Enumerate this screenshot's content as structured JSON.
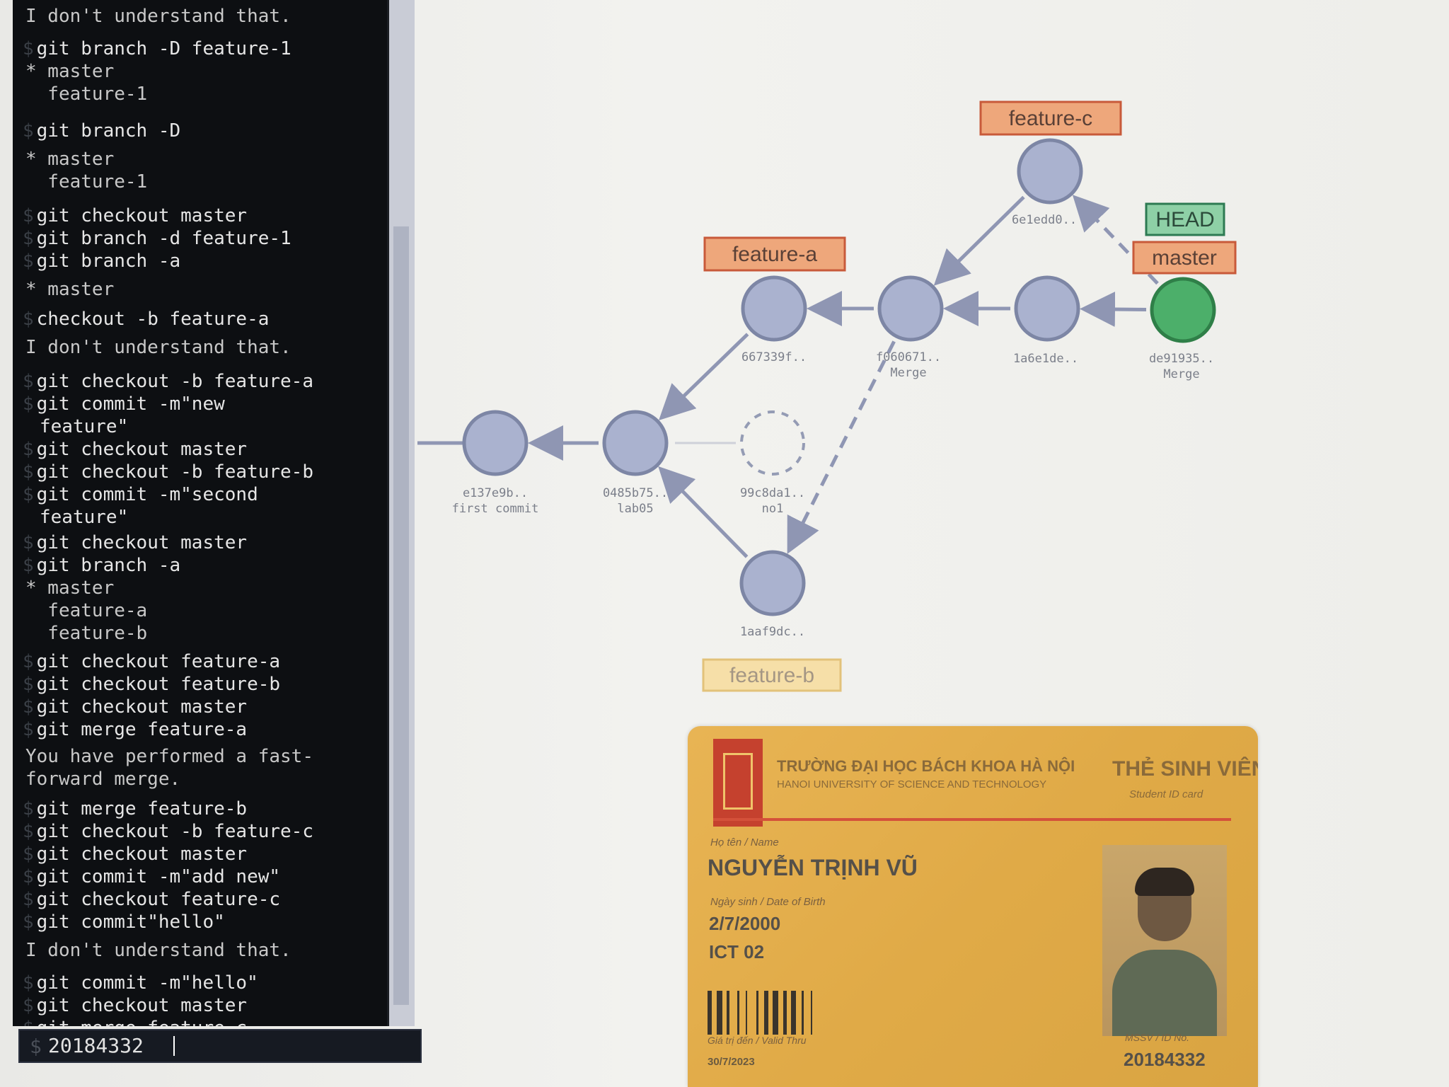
{
  "terminal": {
    "lines": [
      {
        "type": "out",
        "text": "I don't understand that.",
        "faded": true
      },
      {
        "type": "cmd",
        "text": "git branch -D feature-1"
      },
      {
        "type": "out",
        "text": "* master"
      },
      {
        "type": "out",
        "text": "  feature-1"
      },
      {
        "type": "cmd",
        "text": "git branch -D"
      },
      {
        "type": "out",
        "text": "* master"
      },
      {
        "type": "out",
        "text": "  feature-1"
      },
      {
        "type": "cmd",
        "text": "git checkout master"
      },
      {
        "type": "cmd",
        "text": "git branch -d feature-1"
      },
      {
        "type": "cmd",
        "text": "git branch -a"
      },
      {
        "type": "out",
        "text": "* master"
      },
      {
        "type": "cmd",
        "text": "checkout -b feature-a"
      },
      {
        "type": "out",
        "text": "I don't understand that."
      },
      {
        "type": "cmd",
        "text": "git checkout -b feature-a"
      },
      {
        "type": "cmd",
        "text": "git commit -m\"new"
      },
      {
        "type": "cont",
        "text": "feature\""
      },
      {
        "type": "cmd",
        "text": "git checkout master"
      },
      {
        "type": "cmd",
        "text": "git checkout -b feature-b"
      },
      {
        "type": "cmd",
        "text": "git commit -m\"second"
      },
      {
        "type": "cont",
        "text": "feature\""
      },
      {
        "type": "cmd",
        "text": "git checkout master"
      },
      {
        "type": "cmd",
        "text": "git branch -a"
      },
      {
        "type": "out",
        "text": "* master"
      },
      {
        "type": "out",
        "text": "  feature-a"
      },
      {
        "type": "out",
        "text": "  feature-b"
      },
      {
        "type": "cmd",
        "text": "git checkout feature-a"
      },
      {
        "type": "cmd",
        "text": "git checkout feature-b"
      },
      {
        "type": "cmd",
        "text": "git checkout master"
      },
      {
        "type": "cmd",
        "text": "git merge feature-a"
      },
      {
        "type": "out",
        "text": "You have performed a fast-"
      },
      {
        "type": "out",
        "text": "forward merge."
      },
      {
        "type": "cmd",
        "text": "git merge feature-b"
      },
      {
        "type": "cmd",
        "text": "git checkout -b feature-c"
      },
      {
        "type": "cmd",
        "text": "git checkout master"
      },
      {
        "type": "cmd",
        "text": "git commit -m\"add new\""
      },
      {
        "type": "cmd",
        "text": "git checkout feature-c"
      },
      {
        "type": "cmd",
        "text": "git commit\"hello\""
      },
      {
        "type": "out",
        "text": "I don't understand that."
      },
      {
        "type": "cmd",
        "text": "git commit -m\"hello\""
      },
      {
        "type": "cmd",
        "text": "git checkout master"
      },
      {
        "type": "cmd",
        "text": "git merge feature-c"
      }
    ],
    "prompt_symbol": "$",
    "input_value": "20184332"
  },
  "graph": {
    "commits": [
      {
        "id": "e137e9b..",
        "message": "first commit",
        "style": "normal"
      },
      {
        "id": "0485b75..",
        "message": "lab05",
        "style": "normal"
      },
      {
        "id": "99c8da1..",
        "message": "no1",
        "style": "ghost"
      },
      {
        "id": "1aaf9dc..",
        "message": "",
        "style": "normal"
      },
      {
        "id": "667339f..",
        "message": "",
        "style": "normal"
      },
      {
        "id": "f060671..",
        "message": "Merge",
        "style": "normal"
      },
      {
        "id": "1a6e1de..",
        "message": "",
        "style": "normal"
      },
      {
        "id": "6e1edd0..",
        "message": "",
        "style": "normal"
      },
      {
        "id": "de91935..",
        "message": "Merge",
        "style": "head"
      }
    ],
    "branches": [
      {
        "name": "feature-c",
        "style": "active"
      },
      {
        "name": "feature-a",
        "style": "active"
      },
      {
        "name": "master",
        "style": "active"
      },
      {
        "name": "feature-b",
        "style": "inactive"
      }
    ],
    "head_label": "HEAD",
    "colors": {
      "commit_fill": "#aab2cf",
      "commit_stroke": "#7d86a5",
      "head_fill": "#4caf6a",
      "head_stroke": "#2f7f48",
      "branch_fill": "#eea77b",
      "branch_stroke": "#c85a3a",
      "branch_inactive_fill": "#f6dfa8",
      "branch_inactive_stroke": "#e2c27a",
      "head_box_fill": "#8ed0a6",
      "head_box_stroke": "#2d7a52",
      "arrow": "#8f96b3"
    }
  },
  "id_card": {
    "university_vn": "TRƯỜNG ĐẠI HỌC BÁCH KHOA HÀ NỘI",
    "university_en": "HANOI UNIVERSITY OF SCIENCE AND TECHNOLOGY",
    "title": "THẺ SINH VIÊN",
    "subtitle": "Student ID card",
    "name_label": "Họ tên / Name",
    "name": "NGUYỄN TRỊNH VŨ",
    "dob_label": "Ngày sinh / Date of Birth",
    "dob": "2/7/2000",
    "class": "ICT 02",
    "valid_label": "Giá trị đến / Valid Thru",
    "valid": "30/7/2023",
    "mssv_label": "MSSV / ID No.",
    "mssv": "20184332"
  }
}
